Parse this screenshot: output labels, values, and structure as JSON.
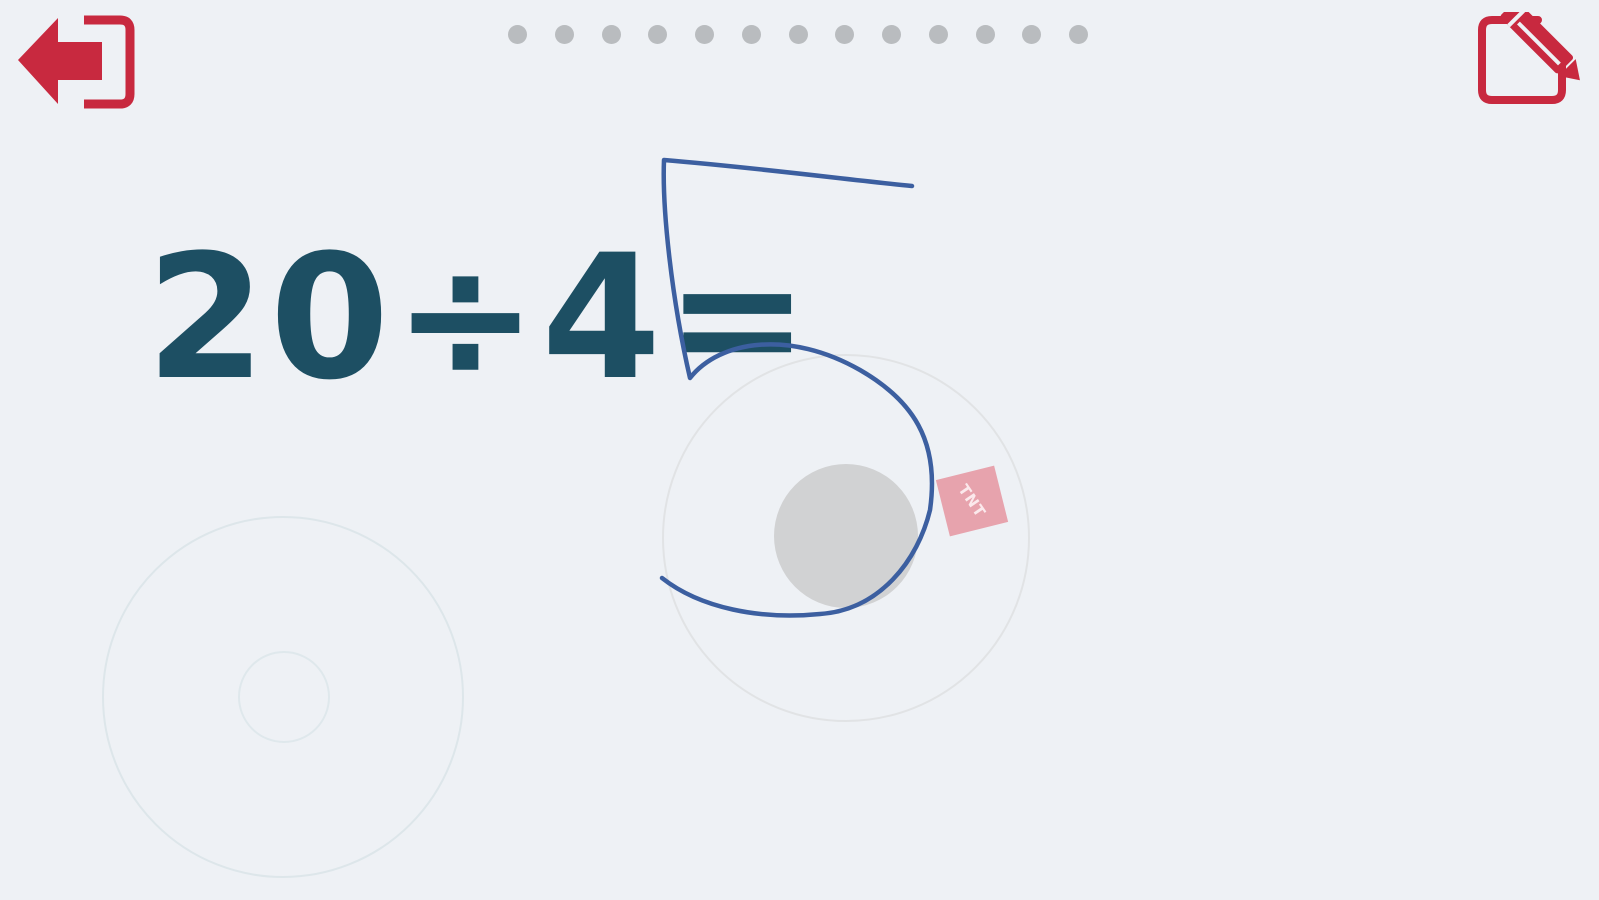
{
  "header": {
    "progress_dot_count": 13,
    "exit_icon": "exit-arrow-icon",
    "edit_icon": "edit-pencil-icon"
  },
  "equation": {
    "text": "20÷4="
  },
  "answer": {
    "handwritten_value": "5",
    "stroke_color": "#3c5fa0"
  },
  "sticker": {
    "text": "TNT"
  },
  "colors": {
    "accent": "#c8293f",
    "equation": "#1d4f63",
    "background": "#eef1f5",
    "dot": "#b9bcbf"
  }
}
